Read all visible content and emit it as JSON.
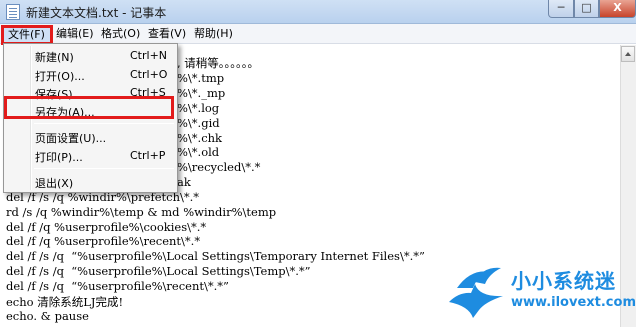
{
  "window": {
    "title": "新建文本文档.txt - 记事本",
    "buttons": {
      "minimize": "─",
      "maximize": "□",
      "close": "X"
    }
  },
  "menubar": {
    "file": "文件(F)",
    "edit": "编辑(E)",
    "format": "格式(O)",
    "view": "查看(V)",
    "help": "帮助(H)"
  },
  "file_menu": {
    "items": [
      {
        "label": "新建(N)",
        "shortcut": "Ctrl+N"
      },
      {
        "label": "打开(O)...",
        "shortcut": "Ctrl+O"
      },
      {
        "label": "保存(S)",
        "shortcut": "Ctrl+S"
      },
      {
        "label": "另存为(A)...",
        "shortcut": ""
      },
      {
        "label": "页面设置(U)...",
        "shortcut": ""
      },
      {
        "label": "打印(P)...",
        "shortcut": "Ctrl+P"
      },
      {
        "label": "退出(X)",
        "shortcut": ""
      }
    ]
  },
  "editor": {
    "lines": [
      ", 请稍等。。。。。。",
      "%\\*.tmp",
      "%\\*._mp",
      "%\\*.log",
      "%\\*.gid",
      "%\\*.chk",
      "%\\*.old",
      "%\\recycled\\*.*",
      "ak",
      "del /f /s /q %windir%\\prefetch\\*.*",
      "rd /s /q %windir%\\temp & md %windir%\\temp",
      "del /f /q %userprofile%\\cookies\\*.*",
      "del /f /q %userprofile%\\recent\\*.*",
      "del /f /s /q  “%userprofile%\\Local Settings\\Temporary Internet Files\\*.*”",
      "del /f /s /q  “%userprofile%\\Local Settings\\Temp\\*.*”",
      "del /f /s /q  “%userprofile%\\recent\\*.*”",
      "echo 清除系统LJ完成!",
      "echo. & pause"
    ]
  },
  "watermark": {
    "name": "小小系统迷",
    "url": "www.ilovext.com",
    "brand_color": "#1e8ce0"
  }
}
